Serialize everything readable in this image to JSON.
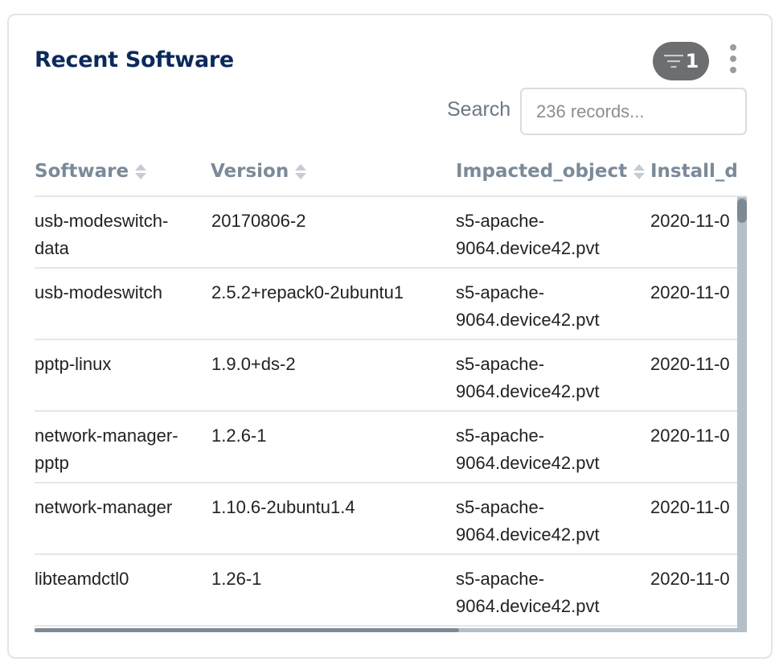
{
  "widget": {
    "title": "Recent Software",
    "filter": {
      "icon": "filter-icon",
      "count": "1"
    },
    "menu_icon": "kebab-menu-icon"
  },
  "search": {
    "label": "Search",
    "placeholder": "236 records..."
  },
  "table": {
    "columns": [
      {
        "label": "Software",
        "sortable": true
      },
      {
        "label": "Version",
        "sortable": true
      },
      {
        "label": "Impacted_object",
        "sortable": true
      },
      {
        "label": "Install_dat",
        "sortable": false
      }
    ],
    "rows": [
      {
        "software": "usb-modeswitch-data",
        "version": "20170806-2",
        "impacted_object": "s5-apache-9064.device42.pvt",
        "install_date": "2020-11-0"
      },
      {
        "software": "usb-modeswitch",
        "version": "2.5.2+repack0-2ubuntu1",
        "impacted_object": "s5-apache-9064.device42.pvt",
        "install_date": "2020-11-0"
      },
      {
        "software": "pptp-linux",
        "version": "1.9.0+ds-2",
        "impacted_object": "s5-apache-9064.device42.pvt",
        "install_date": "2020-11-0"
      },
      {
        "software": "network-manager-pptp",
        "version": "1.2.6-1",
        "impacted_object": "s5-apache-9064.device42.pvt",
        "install_date": "2020-11-0"
      },
      {
        "software": "network-manager",
        "version": "1.10.6-2ubuntu1.4",
        "impacted_object": "s5-apache-9064.device42.pvt",
        "install_date": "2020-11-0"
      },
      {
        "software": "libteamdctl0",
        "version": "1.26-1",
        "impacted_object": "s5-apache-9064.device42.pvt",
        "install_date": "2020-11-0"
      }
    ]
  },
  "colors": {
    "title": "#0b2a5b",
    "header_text": "#7a8a99",
    "filter_bg": "#6d6e70"
  }
}
